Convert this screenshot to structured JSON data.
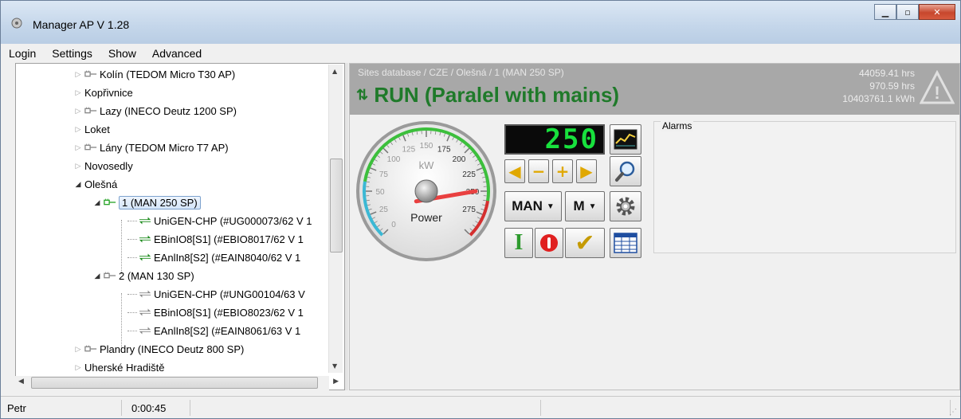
{
  "window": {
    "title": "Manager AP   V 1.28"
  },
  "menu": [
    "Login",
    "Settings",
    "Show",
    "Advanced"
  ],
  "tree": [
    {
      "label": "Kolín (TEDOM Micro T30 AP)",
      "icon": "plug-icon",
      "expander": "closed"
    },
    {
      "label": "Kopřivnice",
      "icon": "",
      "expander": "closed"
    },
    {
      "label": "Lazy (INECO Deutz 1200 SP)",
      "icon": "plug-icon",
      "expander": "closed"
    },
    {
      "label": "Loket",
      "icon": "",
      "expander": "closed"
    },
    {
      "label": "Lány (TEDOM Micro T7 AP)",
      "icon": "plug-icon",
      "expander": "closed"
    },
    {
      "label": "Novosedly",
      "icon": "",
      "expander": "closed"
    },
    {
      "label": "Olešná",
      "icon": "",
      "expander": "open"
    },
    {
      "label": "1 (MAN 250 SP)",
      "icon": "plug-green-icon",
      "expander": "open",
      "selected": true
    },
    {
      "label": "UniGEN-CHP (#UG000073/62  V 1",
      "icon": "transfer-green-icon"
    },
    {
      "label": "EBinIO8[S1] (#EBIO8017/62  V 1",
      "icon": "transfer-green-icon"
    },
    {
      "label": "EAnlIn8[S2] (#EAIN8040/62  V 1",
      "icon": "transfer-green-icon"
    },
    {
      "label": "2 (MAN 130 SP)",
      "icon": "plug-icon",
      "expander": "open"
    },
    {
      "label": "UniGEN-CHP (#UNG00104/63  V",
      "icon": "transfer-gray-icon"
    },
    {
      "label": "EBinIO8[S1] (#EBIO8023/62  V 1",
      "icon": "transfer-gray-icon"
    },
    {
      "label": "EAnlIn8[S2] (#EAIN8061/63  V 1",
      "icon": "transfer-gray-icon"
    },
    {
      "label": "Plandry (INECO Deutz 800 SP)",
      "icon": "plug-icon",
      "expander": "closed"
    },
    {
      "label": "Uherské Hradiště",
      "icon": "",
      "expander": "closed"
    }
  ],
  "header": {
    "breadcrumb": "Sites database / CZE / Olešná / 1 (MAN 250 SP)",
    "status": "RUN (Paralel with mains)",
    "hours1": "44059.41 hrs",
    "hours2": "970.59 hrs",
    "energy": "10403761.1 kWh"
  },
  "gauge": {
    "label": "Power",
    "unit": "kW",
    "ticks": [
      "0",
      "25",
      "50",
      "75",
      "100",
      "125",
      "150",
      "175",
      "200",
      "225",
      "250",
      "275"
    ],
    "value": 250,
    "max": 300
  },
  "controls": {
    "display": "250",
    "mode": "MAN",
    "submode": "M"
  },
  "alarms": {
    "label": "Alarms"
  },
  "statusbar": {
    "user": "Petr",
    "time": "0:00:45"
  },
  "colors": {
    "run_green": "#1f7a2a",
    "header_gray": "#a8a8a8",
    "display_green": "#18e13d"
  }
}
